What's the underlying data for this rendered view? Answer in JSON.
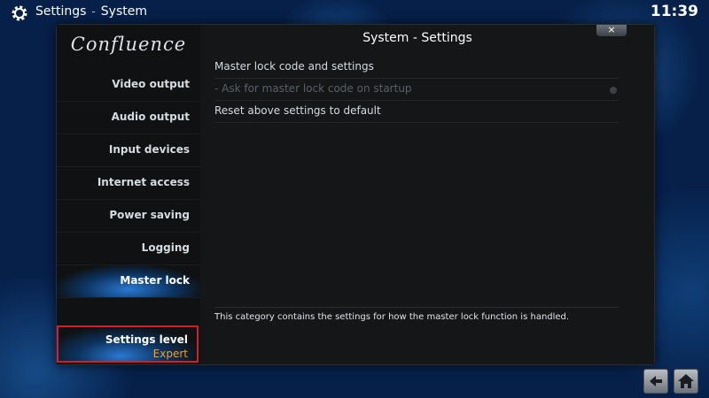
{
  "topbar": {
    "app": "Settings",
    "separator": "-",
    "section": "System",
    "time": "11:39"
  },
  "dialog": {
    "logo": "Confluence",
    "title": "System - Settings",
    "close_label": "×",
    "sidebar": [
      {
        "label": "Video output"
      },
      {
        "label": "Audio output"
      },
      {
        "label": "Input devices"
      },
      {
        "label": "Internet access"
      },
      {
        "label": "Power saving"
      },
      {
        "label": "Logging"
      },
      {
        "label": "Master lock",
        "active": true
      }
    ],
    "settings_level": {
      "label": "Settings level",
      "value": "Expert"
    },
    "rows": [
      {
        "label": "Master lock code and settings",
        "enabled": true
      },
      {
        "label": "- Ask for master lock code on startup",
        "enabled": false,
        "radio": true
      },
      {
        "label": "Reset above settings to default",
        "enabled": true
      }
    ],
    "description": "This category contains the settings for how the master lock function is handled."
  },
  "icons": [
    "gear-icon",
    "back-arrow-icon",
    "home-icon",
    "close-icon"
  ]
}
